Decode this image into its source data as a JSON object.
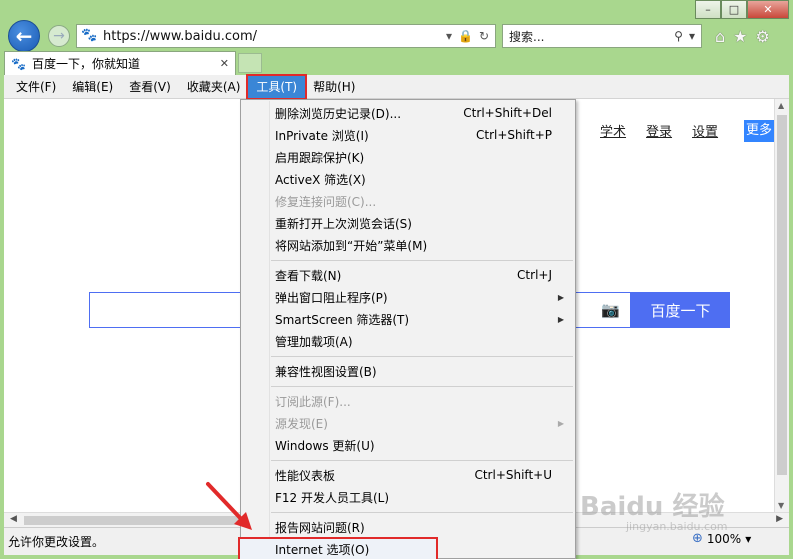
{
  "window": {
    "caption": {
      "minimize": "–",
      "maximize": "□",
      "close": "✕"
    }
  },
  "nav": {
    "back_icon": "←",
    "forward_icon": "→",
    "address": "https://www.baidu.com/",
    "address_icons": {
      "lock": "🔒",
      "dropdown": "▾",
      "refresh": "↻"
    },
    "search_placeholder": "搜索...",
    "search_icons": {
      "search": "⚲",
      "dropdown": "▾"
    },
    "right_icons": {
      "home": "⌂",
      "favorites": "★",
      "settings": "⚙"
    }
  },
  "tab": {
    "title": "百度一下，你就知道",
    "close": "✕",
    "icon": "🐾"
  },
  "menubar": {
    "items": [
      {
        "label": "文件(F)"
      },
      {
        "label": "编辑(E)"
      },
      {
        "label": "查看(V)"
      },
      {
        "label": "收藏夹(A)"
      },
      {
        "label": "工具(T)"
      },
      {
        "label": "帮助(H)"
      }
    ]
  },
  "page": {
    "links": [
      "学术",
      "登录",
      "设置"
    ],
    "more": "更多",
    "search_button": "百度一下",
    "camera_icon": "📷"
  },
  "tools_menu": {
    "items": [
      {
        "label": "删除浏览历史记录(D)...",
        "shortcut": "Ctrl+Shift+Del"
      },
      {
        "label": "InPrivate 浏览(I)",
        "shortcut": "Ctrl+Shift+P"
      },
      {
        "label": "启用跟踪保护(K)",
        "shortcut": ""
      },
      {
        "label": "ActiveX 筛选(X)",
        "shortcut": ""
      },
      {
        "label": "修复连接问题(C)...",
        "shortcut": ""
      },
      {
        "label": "重新打开上次浏览会话(S)",
        "shortcut": ""
      },
      {
        "label": "将网站添加到“开始”菜单(M)",
        "shortcut": ""
      },
      {
        "label": "查看下载(N)",
        "shortcut": "Ctrl+J"
      },
      {
        "label": "弹出窗口阻止程序(P)",
        "shortcut": ""
      },
      {
        "label": "SmartScreen 筛选器(T)",
        "shortcut": ""
      },
      {
        "label": "管理加载项(A)",
        "shortcut": ""
      },
      {
        "label": "兼容性视图设置(B)",
        "shortcut": ""
      },
      {
        "label": "订阅此源(F)...",
        "shortcut": ""
      },
      {
        "label": "源发现(E)",
        "shortcut": ""
      },
      {
        "label": "Windows 更新(U)",
        "shortcut": ""
      },
      {
        "label": "性能仪表板",
        "shortcut": "Ctrl+Shift+U"
      },
      {
        "label": "F12 开发人员工具(L)",
        "shortcut": ""
      },
      {
        "label": "报告网站问题(R)",
        "shortcut": ""
      },
      {
        "label": "Internet 选项(O)",
        "shortcut": ""
      }
    ],
    "submenu_arrow": "▶"
  },
  "status": {
    "text": "允许你更改设置。",
    "zoom": "100%",
    "zoom_icon": "⊕",
    "zoom_dropdown": "▾"
  },
  "watermark": {
    "text": "Baidu 经验",
    "sub": "jingyan.baidu.com"
  }
}
